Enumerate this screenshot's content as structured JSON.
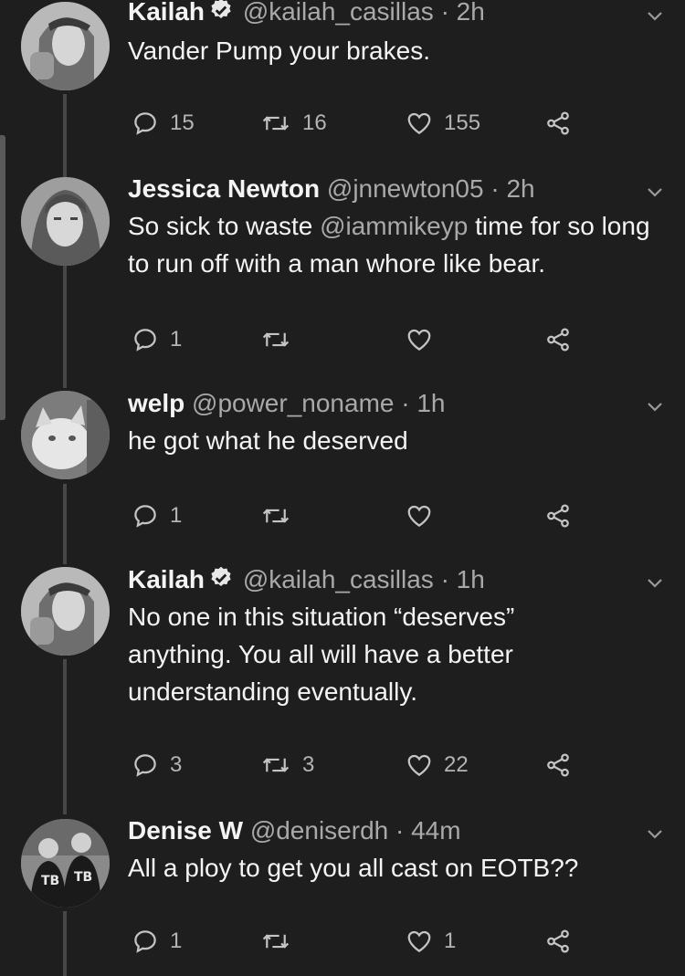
{
  "tweets": [
    {
      "name": "Kailah",
      "verified": true,
      "handle": "@kailah_casillas",
      "dot": "·",
      "time": "2h",
      "text_parts": [
        "Vander Pump your brakes."
      ],
      "mention": "",
      "text_after": "",
      "replies": "15",
      "retweets": "16",
      "likes": "155"
    },
    {
      "name": "Jessica Newton",
      "verified": false,
      "handle": "@jnnewton05",
      "dot": "·",
      "time": "2h",
      "text_parts": [
        "So sick to waste "
      ],
      "mention": "@iammikeyp",
      "text_after": " time for so long to run off with a man whore like bear.",
      "replies": "1",
      "retweets": "",
      "likes": ""
    },
    {
      "name": "welp",
      "verified": false,
      "handle": "@power_noname",
      "dot": "·",
      "time": "1h",
      "text_parts": [
        "he got what he deserved"
      ],
      "mention": "",
      "text_after": "",
      "replies": "1",
      "retweets": "",
      "likes": ""
    },
    {
      "name": "Kailah",
      "verified": true,
      "handle": "@kailah_casillas",
      "dot": "·",
      "time": "1h",
      "text_parts": [
        "No one in this situation “deserves” anything. You all will have a better understanding eventually."
      ],
      "mention": "",
      "text_after": "",
      "replies": "3",
      "retweets": "3",
      "likes": "22"
    },
    {
      "name": "Denise W",
      "verified": false,
      "handle": "@deniserdh",
      "dot": "·",
      "time": "44m",
      "text_parts": [
        "All a ploy to get you all cast on EOTB??"
      ],
      "mention": "",
      "text_after": "",
      "replies": "1",
      "retweets": "",
      "likes": "1"
    }
  ],
  "icons": {
    "reply": "speech-bubble-icon",
    "retweet": "retweet-arrows-icon",
    "like": "heart-icon",
    "share": "share-nodes-icon",
    "menu": "chevron-down-icon",
    "verified": "verified-badge-icon"
  },
  "colors": {
    "background": "#1e1e1e",
    "text": "#f4f4f4",
    "muted": "#a9a9a9",
    "thread_line": "#474747"
  }
}
